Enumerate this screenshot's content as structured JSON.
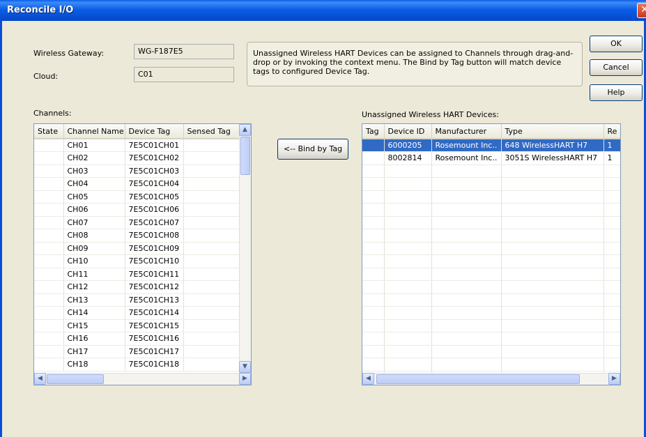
{
  "window": {
    "title": "Reconcile I/O",
    "close_glyph": "✕"
  },
  "gateway": {
    "label": "Wireless Gateway:",
    "value": "WG-F187E5"
  },
  "cloud": {
    "label": "Cloud:",
    "value": "C01"
  },
  "info_text": "Unassigned Wireless HART Devices can be assigned to Channels through drag-and-drop or by invoking the context menu. The Bind by Tag button will match device tags to configured Device Tag.",
  "buttons": {
    "ok": "OK",
    "cancel": "Cancel",
    "help": "Help",
    "bind": "<-- Bind by Tag"
  },
  "channels": {
    "label": "Channels:",
    "columns": [
      "State",
      "Channel Name",
      "Device Tag",
      "Sensed Tag"
    ],
    "rows": [
      [
        "",
        "CH01",
        "7E5C01CH01",
        ""
      ],
      [
        "",
        "CH02",
        "7E5C01CH02",
        ""
      ],
      [
        "",
        "CH03",
        "7E5C01CH03",
        ""
      ],
      [
        "",
        "CH04",
        "7E5C01CH04",
        ""
      ],
      [
        "",
        "CH05",
        "7E5C01CH05",
        ""
      ],
      [
        "",
        "CH06",
        "7E5C01CH06",
        ""
      ],
      [
        "",
        "CH07",
        "7E5C01CH07",
        ""
      ],
      [
        "",
        "CH08",
        "7E5C01CH08",
        ""
      ],
      [
        "",
        "CH09",
        "7E5C01CH09",
        ""
      ],
      [
        "",
        "CH10",
        "7E5C01CH10",
        ""
      ],
      [
        "",
        "CH11",
        "7E5C01CH11",
        ""
      ],
      [
        "",
        "CH12",
        "7E5C01CH12",
        ""
      ],
      [
        "",
        "CH13",
        "7E5C01CH13",
        ""
      ],
      [
        "",
        "CH14",
        "7E5C01CH14",
        ""
      ],
      [
        "",
        "CH15",
        "7E5C01CH15",
        ""
      ],
      [
        "",
        "CH16",
        "7E5C01CH16",
        ""
      ],
      [
        "",
        "CH17",
        "7E5C01CH17",
        ""
      ],
      [
        "",
        "CH18",
        "7E5C01CH18",
        ""
      ]
    ]
  },
  "devices": {
    "label": "Unassigned Wireless HART Devices:",
    "columns": [
      "Tag",
      "Device ID",
      "Manufacturer",
      "Type",
      "Re"
    ],
    "rows": [
      [
        "",
        "6000205",
        "Rosemount Inc..",
        "648 WirelessHART H7",
        "1"
      ],
      [
        "",
        "8002814",
        "Rosemount Inc..",
        "3051S WirelessHART H7",
        "1"
      ]
    ],
    "selected_row": 0,
    "empty_rows": 17
  },
  "colors": {
    "titlebar": "#0a5fe8",
    "selection": "#316ac5",
    "dialog": "#ece9d8"
  }
}
